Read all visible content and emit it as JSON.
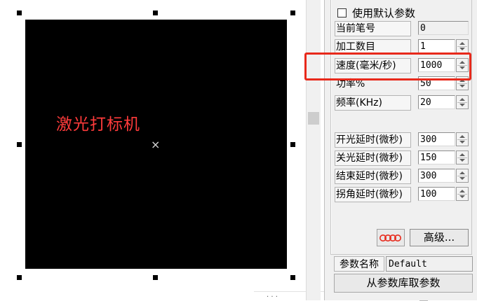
{
  "canvas": {
    "label": "激光打标机",
    "label_color": "#ff3b3b",
    "center_mark": "×"
  },
  "panel": {
    "use_default_params": {
      "label": "使用默认参数",
      "checked": false
    },
    "fields": [
      {
        "key": "pen_no",
        "label": "当前笔号",
        "value": "0",
        "spinner": false
      },
      {
        "key": "mark_count",
        "label": "加工数目",
        "value": "1",
        "spinner": true
      },
      {
        "key": "speed",
        "label": "速度(毫米/秒)",
        "value": "1000",
        "spinner": true
      },
      {
        "key": "power",
        "label": "功率%",
        "value": "50",
        "spinner": true
      },
      {
        "key": "frequency",
        "label": "频率(KHz)",
        "value": "20",
        "spinner": true
      },
      {
        "key": "laser_on_delay",
        "label": "开光延时(微秒)",
        "value": "300",
        "spinner": true
      },
      {
        "key": "laser_off_delay",
        "label": "关光延时(微秒)",
        "value": "150",
        "spinner": true
      },
      {
        "key": "end_delay",
        "label": "结束延时(微秒)",
        "value": "300",
        "spinner": true
      },
      {
        "key": "corner_delay",
        "label": "拐角延时(微秒)",
        "value": "100",
        "spinner": true
      }
    ],
    "advanced_button": "高级...",
    "param_name_label": "参数名称",
    "param_name_value": "Default",
    "load_from_library_button": "从参数库取参数"
  },
  "highlight_color": "#e8291b"
}
